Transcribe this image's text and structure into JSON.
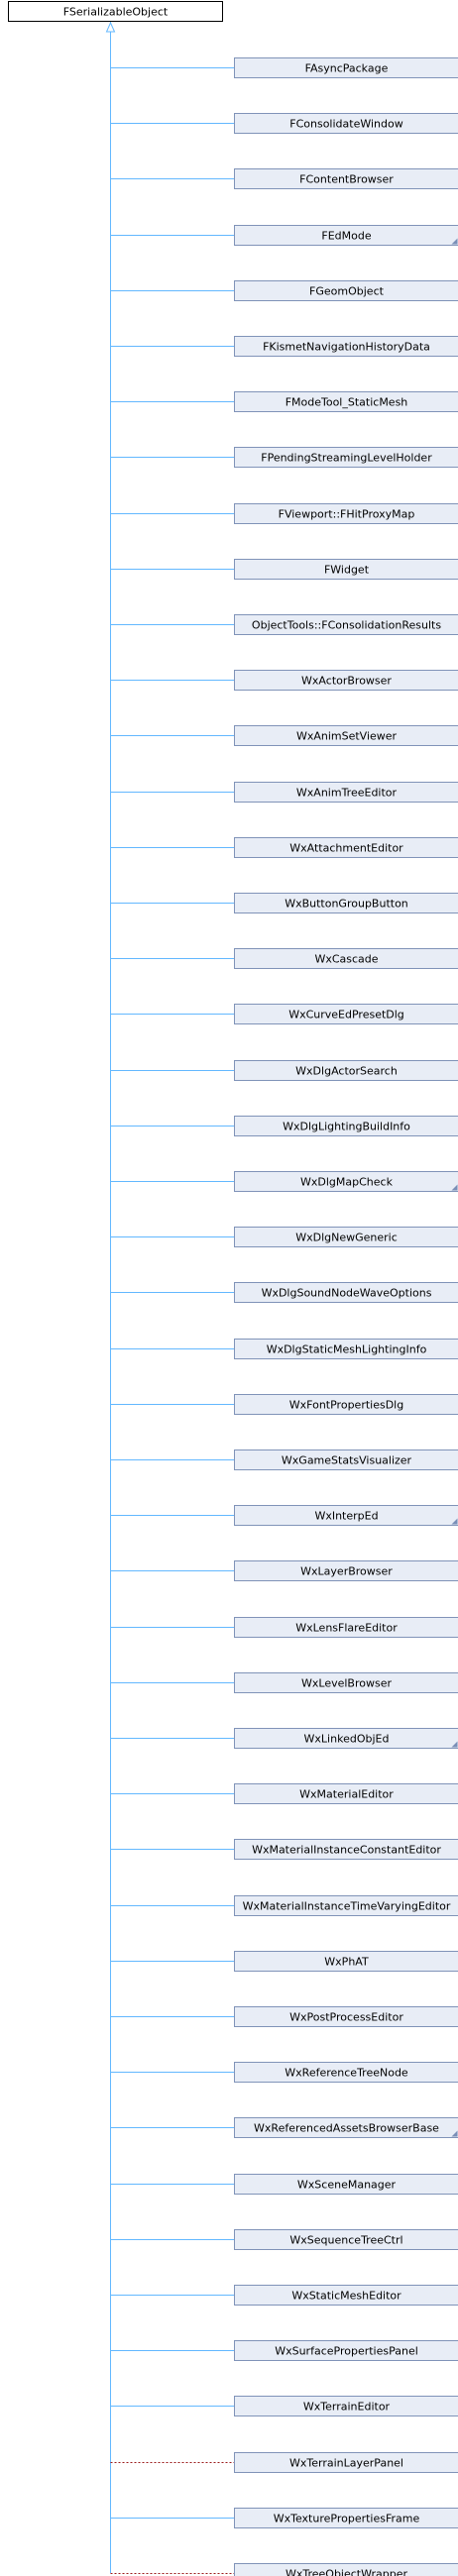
{
  "base_class": {
    "name": "FSerializableObject"
  },
  "derived_classes": [
    {
      "name": "FAsyncPackage",
      "link": "public",
      "has_children": false
    },
    {
      "name": "FConsolidateWindow",
      "link": "public",
      "has_children": false
    },
    {
      "name": "FContentBrowser",
      "link": "public",
      "has_children": false
    },
    {
      "name": "FEdMode",
      "link": "public",
      "has_children": true
    },
    {
      "name": "FGeomObject",
      "link": "public",
      "has_children": false
    },
    {
      "name": "FKismetNavigationHistoryData",
      "link": "public",
      "has_children": false
    },
    {
      "name": "FModeTool_StaticMesh",
      "link": "public",
      "has_children": false
    },
    {
      "name": "FPendingStreamingLevelHolder",
      "link": "public",
      "has_children": false
    },
    {
      "name": "FViewport::FHitProxyMap",
      "link": "public",
      "has_children": false
    },
    {
      "name": "FWidget",
      "link": "public",
      "has_children": false
    },
    {
      "name": "ObjectTools::FConsolidationResults",
      "link": "public",
      "has_children": false
    },
    {
      "name": "WxActorBrowser",
      "link": "public",
      "has_children": false
    },
    {
      "name": "WxAnimSetViewer",
      "link": "public",
      "has_children": false
    },
    {
      "name": "WxAnimTreeEditor",
      "link": "public",
      "has_children": false
    },
    {
      "name": "WxAttachmentEditor",
      "link": "public",
      "has_children": false
    },
    {
      "name": "WxButtonGroupButton",
      "link": "public",
      "has_children": false
    },
    {
      "name": "WxCascade",
      "link": "public",
      "has_children": false
    },
    {
      "name": "WxCurveEdPresetDlg",
      "link": "public",
      "has_children": false
    },
    {
      "name": "WxDlgActorSearch",
      "link": "public",
      "has_children": false
    },
    {
      "name": "WxDlgLightingBuildInfo",
      "link": "public",
      "has_children": false
    },
    {
      "name": "WxDlgMapCheck",
      "link": "public",
      "has_children": true
    },
    {
      "name": "WxDlgNewGeneric",
      "link": "public",
      "has_children": false
    },
    {
      "name": "WxDlgSoundNodeWaveOptions",
      "link": "public",
      "has_children": false
    },
    {
      "name": "WxDlgStaticMeshLightingInfo",
      "link": "public",
      "has_children": false
    },
    {
      "name": "WxFontPropertiesDlg",
      "link": "public",
      "has_children": false
    },
    {
      "name": "WxGameStatsVisualizer",
      "link": "public",
      "has_children": false
    },
    {
      "name": "WxInterpEd",
      "link": "public",
      "has_children": true
    },
    {
      "name": "WxLayerBrowser",
      "link": "public",
      "has_children": false
    },
    {
      "name": "WxLensFlareEditor",
      "link": "public",
      "has_children": false
    },
    {
      "name": "WxLevelBrowser",
      "link": "public",
      "has_children": false
    },
    {
      "name": "WxLinkedObjEd",
      "link": "public",
      "has_children": true
    },
    {
      "name": "WxMaterialEditor",
      "link": "public",
      "has_children": false
    },
    {
      "name": "WxMaterialInstanceConstantEditor",
      "link": "public",
      "has_children": false
    },
    {
      "name": "WxMaterialInstanceTimeVaryingEditor",
      "link": "public",
      "has_children": false
    },
    {
      "name": "WxPhAT",
      "link": "public",
      "has_children": false
    },
    {
      "name": "WxPostProcessEditor",
      "link": "public",
      "has_children": false
    },
    {
      "name": "WxReferenceTreeNode",
      "link": "public",
      "has_children": false
    },
    {
      "name": "WxReferencedAssetsBrowserBase",
      "link": "public",
      "has_children": true
    },
    {
      "name": "WxSceneManager",
      "link": "public",
      "has_children": false
    },
    {
      "name": "WxSequenceTreeCtrl",
      "link": "public",
      "has_children": false
    },
    {
      "name": "WxStaticMeshEditor",
      "link": "public",
      "has_children": false
    },
    {
      "name": "WxSurfacePropertiesPanel",
      "link": "public",
      "has_children": false
    },
    {
      "name": "WxTerrainEditor",
      "link": "public",
      "has_children": false
    },
    {
      "name": "WxTerrainLayerPanel",
      "link": "private",
      "has_children": false
    },
    {
      "name": "WxTexturePropertiesFrame",
      "link": "public",
      "has_children": false
    },
    {
      "name": "WxTreeObjectWrapper",
      "link": "private",
      "has_children": true
    }
  ],
  "colors": {
    "base_fill": "#ffffff",
    "base_stroke": "#000000",
    "node_fill": "#e8edf6",
    "node_stroke": "#8093b8",
    "public_edge": "#63b8ff",
    "private_edge": "#9a1b1b",
    "corner_marker": "#7a8fb7"
  }
}
